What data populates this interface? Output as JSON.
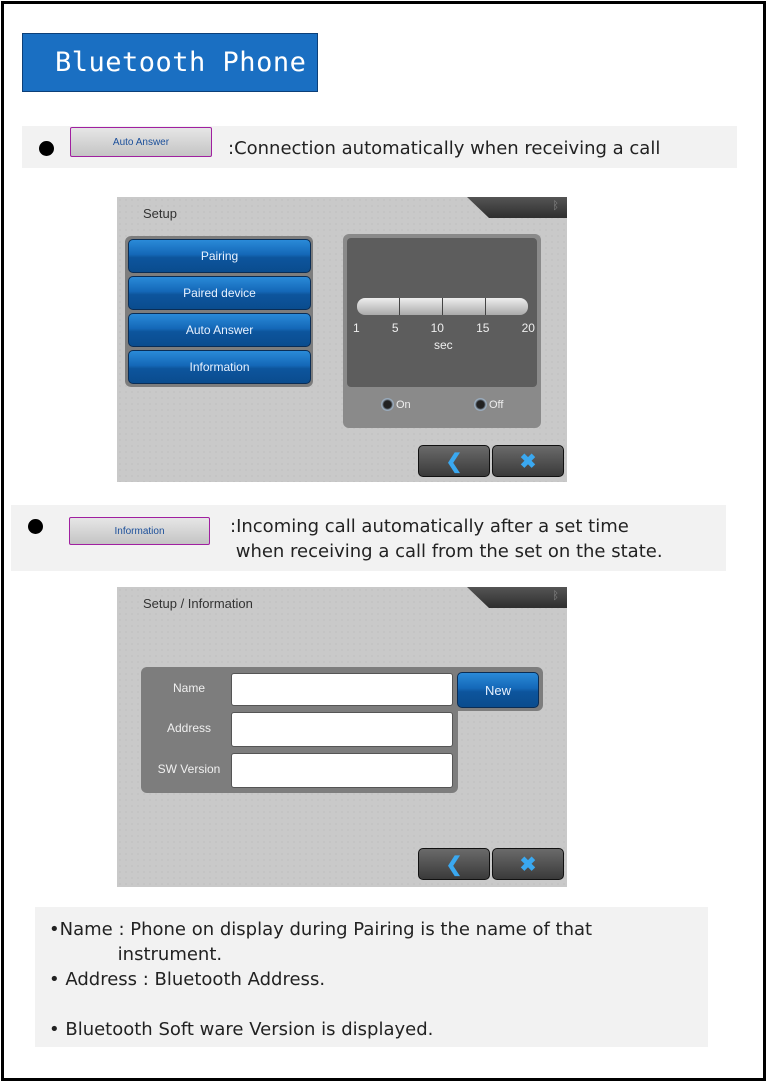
{
  "title": "Bluetooth Phone",
  "section1": {
    "button_label": "Auto Answer",
    "description": ":Connection automatically when receiving a call"
  },
  "screen1": {
    "title": "Setup",
    "menu": [
      "Pairing",
      "Paired device",
      "Auto Answer",
      "Information"
    ],
    "slider": {
      "ticks": [
        "1",
        "5",
        "10",
        "15",
        "20"
      ],
      "unit": "sec"
    },
    "radios": {
      "on": "On",
      "off": "Off",
      "selected": "none"
    },
    "back_icon": "chevron-left-icon",
    "close_icon": "x-icon",
    "status_icon": "bluetooth-icon"
  },
  "section2": {
    "button_label": "Information",
    "description": ":Incoming call automatically after a set time\n when receiving a call from the set on the state."
  },
  "screen2": {
    "title": "Setup / Information",
    "fields": [
      {
        "label": "Name",
        "value": ""
      },
      {
        "label": "Address",
        "value": ""
      },
      {
        "label": "SW Version",
        "value": ""
      }
    ],
    "new_button": "New"
  },
  "notes": "•Name : Phone on display during Pairing is the name of that\n            instrument.\n• Address : Bluetooth Address.\n\n• Bluetooth Soft ware Version is displayed.",
  "colors": {
    "title_bg": "#1a6fc2",
    "button_blue": "#1468b8",
    "band": "#f2f2f2"
  }
}
